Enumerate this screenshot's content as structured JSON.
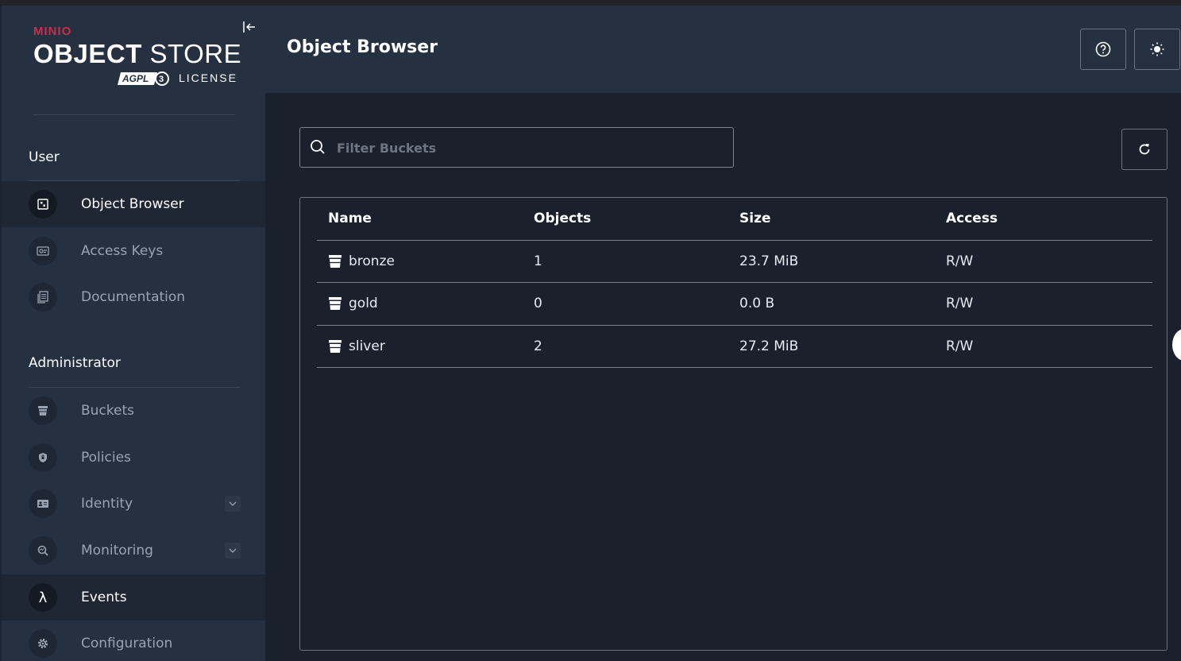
{
  "brand": {
    "minio": "MINIO",
    "main_bold": "OBJECT",
    "main_light": " STORE",
    "license": "LICENSE",
    "agpl": "AGPL"
  },
  "sidebar": {
    "user_section": "User",
    "admin_section": "Administrator",
    "user_items": [
      {
        "label": "Object Browser",
        "icon": "object-browser-icon"
      },
      {
        "label": "Access Keys",
        "icon": "key-icon"
      },
      {
        "label": "Documentation",
        "icon": "document-icon"
      }
    ],
    "admin_items": [
      {
        "label": "Buckets",
        "icon": "bucket-icon"
      },
      {
        "label": "Policies",
        "icon": "shield-icon"
      },
      {
        "label": "Identity",
        "icon": "id-card-icon"
      },
      {
        "label": "Monitoring",
        "icon": "magnifier-icon"
      },
      {
        "label": "Events",
        "icon": "lambda-icon"
      },
      {
        "label": "Configuration",
        "icon": "gear-icon"
      }
    ]
  },
  "header": {
    "title": "Object Browser"
  },
  "search": {
    "placeholder": "Filter Buckets",
    "value": ""
  },
  "table": {
    "columns": [
      "Name",
      "Objects",
      "Size",
      "Access"
    ],
    "rows": [
      {
        "name": "bronze",
        "objects": "1",
        "size": "23.7 MiB",
        "access": "R/W"
      },
      {
        "name": "gold",
        "objects": "0",
        "size": "0.0 B",
        "access": "R/W"
      },
      {
        "name": "sliver",
        "objects": "2",
        "size": "27.2 MiB",
        "access": "R/W"
      }
    ]
  },
  "colors": {
    "brand_red": "#c72e49",
    "sidebar_bg": "#253041",
    "main_bg": "#1a202c"
  }
}
